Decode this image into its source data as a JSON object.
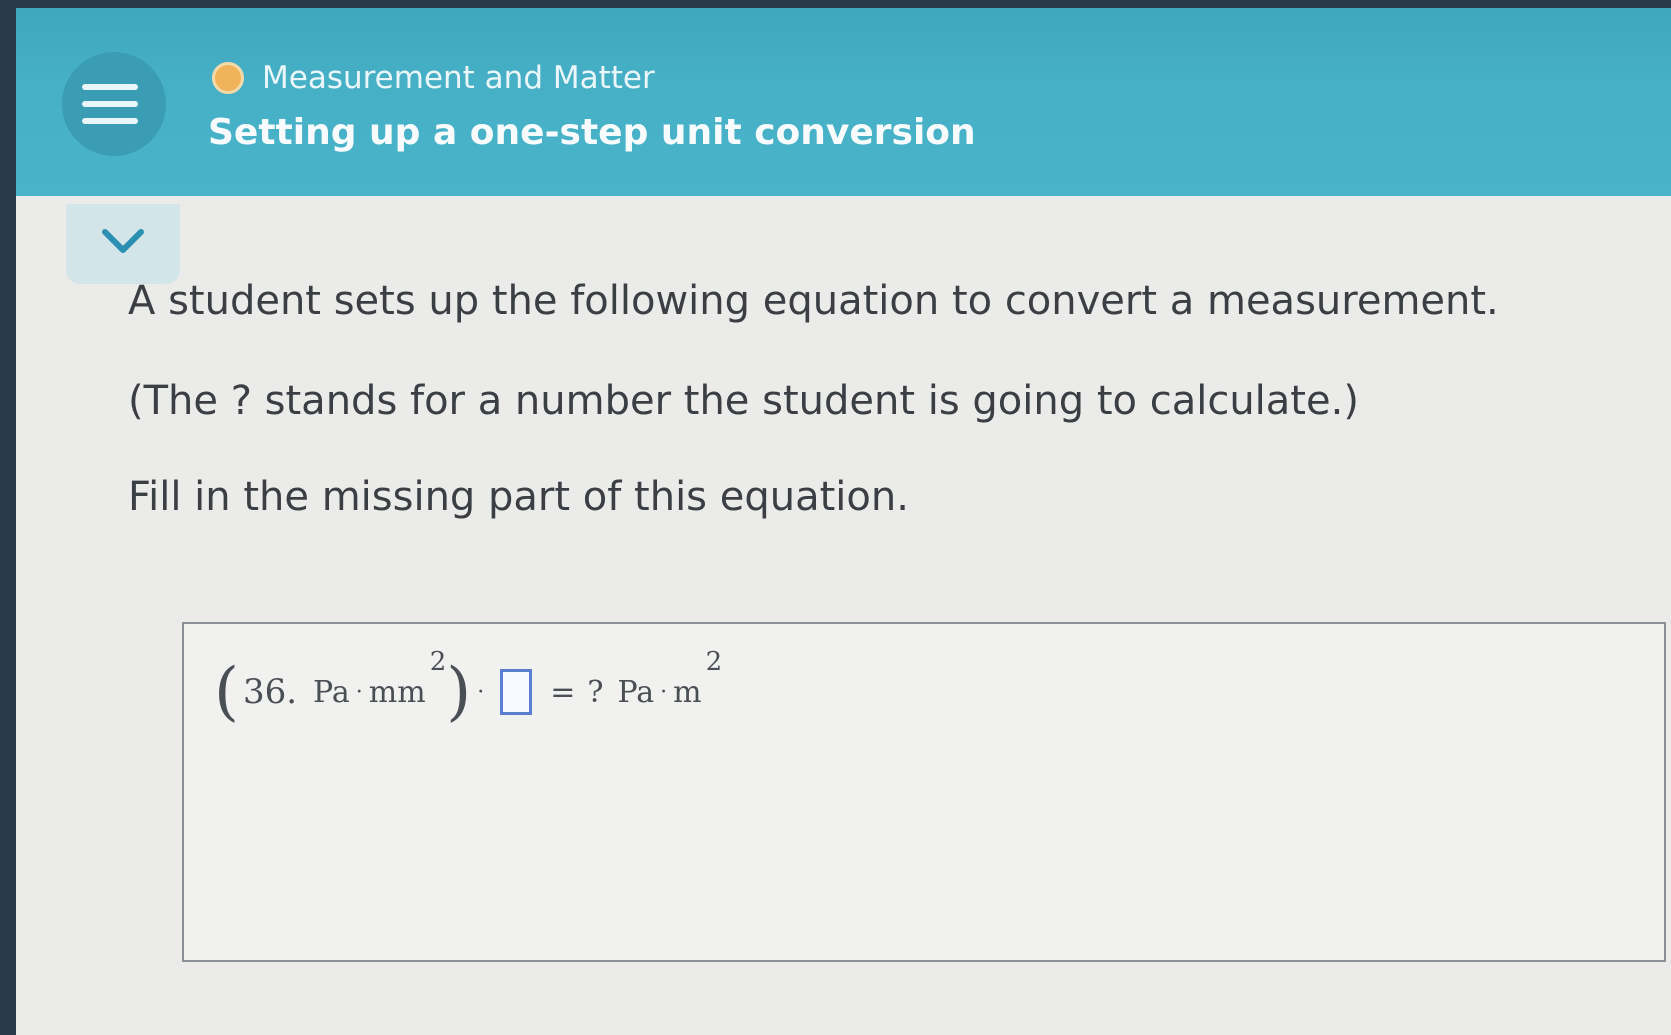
{
  "header": {
    "topic": "Measurement and Matter",
    "title": "Setting up a one-step unit conversion"
  },
  "question": {
    "line1": "A student sets up the following equation to convert a measurement.",
    "line2": "(The ? stands for a number the student is going to calculate.)",
    "line3": "Fill in the missing part of this equation."
  },
  "equation": {
    "left_paren": "(",
    "value": "36.",
    "unit_a": "Pa",
    "dot": "·",
    "unit_b": "mm",
    "exp_left": "2",
    "right_paren": ")",
    "equals": "=",
    "unknown": "?",
    "result_unit_a": "Pa",
    "result_unit_b": "m",
    "exp_right": "2"
  },
  "colors": {
    "header": "#48b3c9",
    "topic_dot": "#f0b35a",
    "input_border": "#5a7fd0"
  },
  "icons": {
    "menu": "hamburger-icon",
    "collapse": "chevron-down-icon"
  }
}
